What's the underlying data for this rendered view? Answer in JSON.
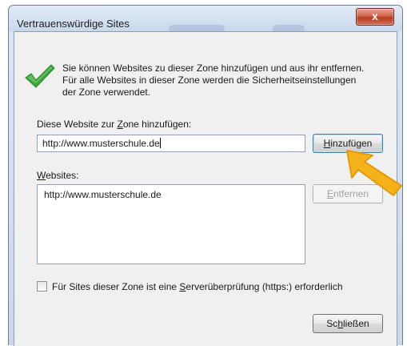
{
  "window": {
    "title": "Vertrauenswürdige Sites",
    "close_label": "x"
  },
  "info": {
    "icon": "check-icon",
    "text": "Sie können Websites zu dieser Zone hinzufügen und aus ihr entfernen. Für alle Websites in dieser Zone werden die Sicherheitseinstellungen der Zone verwendet."
  },
  "add": {
    "label_pre": "Diese Website zur ",
    "label_hotkey": "Z",
    "label_post": "one hinzufügen:",
    "value": "http://www.musterschule.de",
    "button_hotkey": "H",
    "button_rest": "inzufügen"
  },
  "websites": {
    "label_hotkey": "W",
    "label_rest": "ebsites:",
    "items": [
      "http://www.musterschule.de"
    ],
    "remove_hotkey": "E",
    "remove_rest": "ntfernen"
  },
  "https_check": {
    "checked": false,
    "label_pre": "Für Sites dieser Zone ist eine ",
    "label_hotkey": "S",
    "label_post": "erverüberprüfung (https:) erforderlich"
  },
  "close_button": {
    "pre": "Sc",
    "hotkey": "h",
    "post": "ließen"
  },
  "colors": {
    "arrow": "#f5b21a",
    "check": "#3aa53a"
  }
}
